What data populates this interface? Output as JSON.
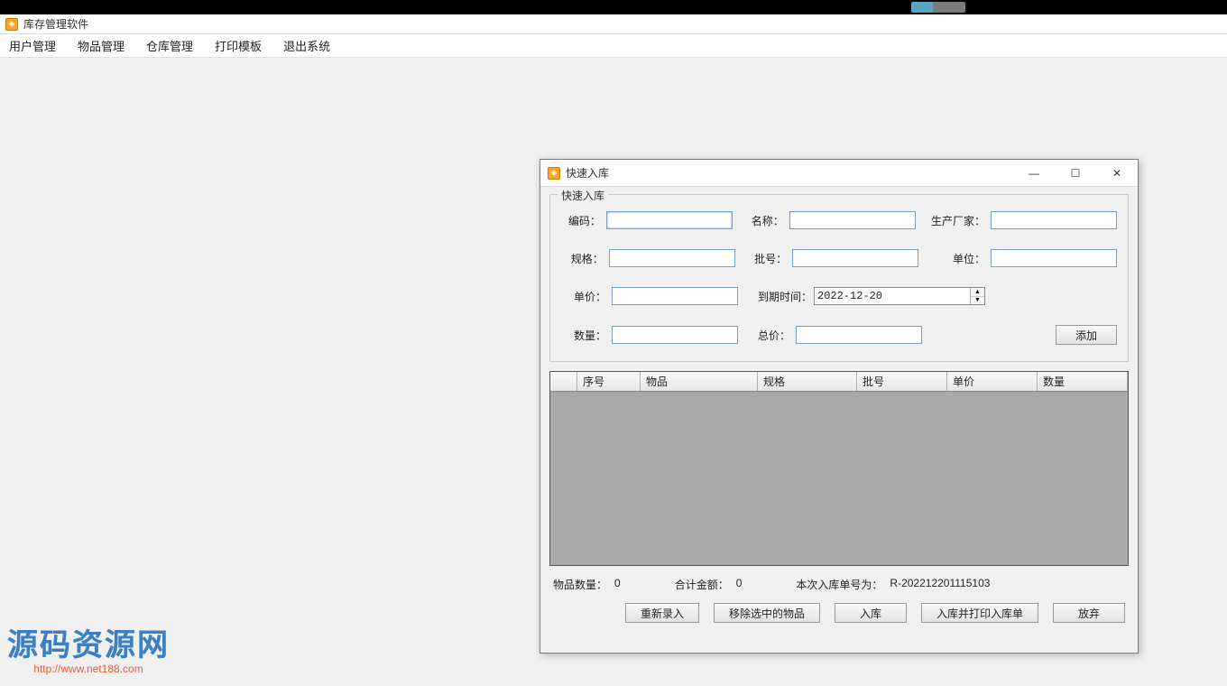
{
  "main_window": {
    "title": "库存管理软件"
  },
  "menu": {
    "items": [
      "用户管理",
      "物品管理",
      "仓库管理",
      "打印模板",
      "退出系统"
    ]
  },
  "dialog": {
    "title": "快速入库",
    "group_label": "快速入库",
    "labels": {
      "code": "编码：",
      "name": "名称：",
      "manufacturer": "生产厂家：",
      "spec": "规格：",
      "batch": "批号：",
      "unit": "单位：",
      "price": "单价：",
      "expire": "到期时间：",
      "qty": "数量：",
      "total": "总价："
    },
    "values": {
      "code": "",
      "name": "",
      "manufacturer": "",
      "spec": "",
      "batch": "",
      "unit": "",
      "price": "",
      "expire": "2022-12-20",
      "qty": "",
      "total": ""
    },
    "add_button": "添加",
    "grid_headers": {
      "index": "序号",
      "item": "物品",
      "spec": "规格",
      "batch": "批号",
      "price": "单价",
      "qty": "数量"
    },
    "status": {
      "qty_label": "物品数量：",
      "qty_value": "0",
      "total_label": "合计金额：",
      "total_value": "0",
      "order_label": "本次入库单号为：",
      "order_value": "R-202212201115103"
    },
    "buttons": {
      "reenter": "重新录入",
      "remove": "移除选中的物品",
      "stockin": "入库",
      "stockin_print": "入库并打印入库单",
      "discard": "放弃"
    }
  },
  "watermark": {
    "main": "源码资源网",
    "sub": "http://www.net188.com"
  }
}
